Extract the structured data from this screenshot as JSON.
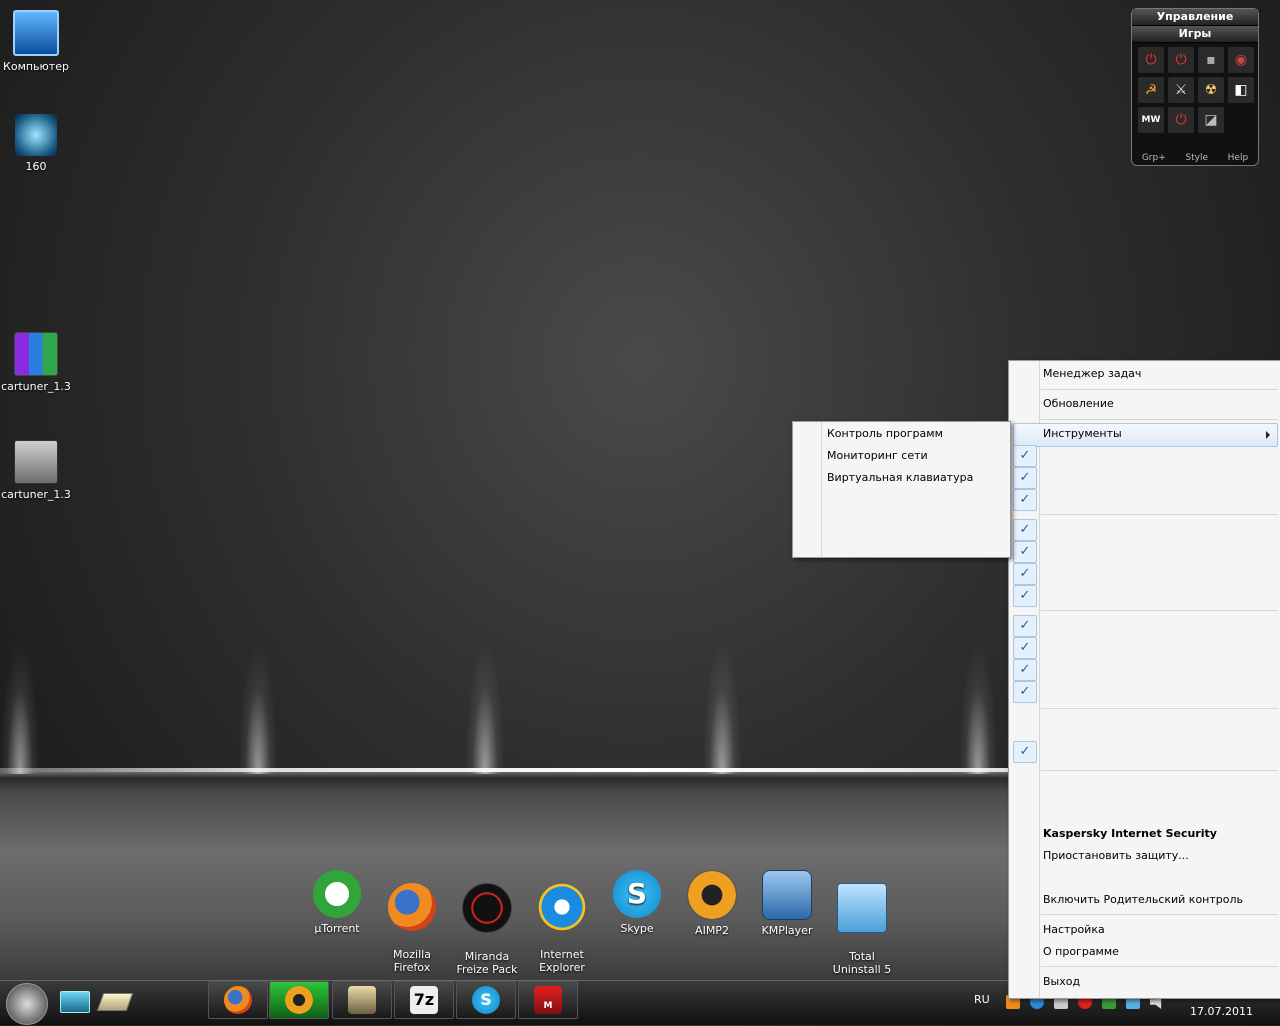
{
  "desktop": {
    "icons": [
      {
        "label": "Компьютер"
      },
      {
        "label": "160"
      },
      {
        "label": "cartuner_1.3"
      },
      {
        "label": "cartuner_1.3"
      }
    ]
  },
  "gadget": {
    "title": "Управление",
    "subtitle": "Игры",
    "footer": [
      "Grp+",
      "Style",
      "Help"
    ],
    "cells": [
      "⏻",
      "⏻",
      "▪",
      "◉",
      "☭",
      "⚔",
      "☢",
      "◧",
      "MW",
      "⏻",
      "◪"
    ]
  },
  "dock": {
    "items": [
      {
        "label": "µTorrent",
        "color": "#2fa53a"
      },
      {
        "label": "Mozilla\nFirefox",
        "color": "#e8641b"
      },
      {
        "label": "Miranda\nFreize Pack",
        "color": "#222222"
      },
      {
        "label": "Internet\nExplorer",
        "color": "#1a8be0"
      },
      {
        "label": "Skype",
        "color": "#19a7e8"
      },
      {
        "label": "AIMP2",
        "color": "#f0a020"
      },
      {
        "label": "KMPlayer",
        "color": "#3a7bbf"
      },
      {
        "label": "Total\nUninstall 5",
        "color": "#4aa0d8"
      }
    ]
  },
  "taskbar": {
    "lang": "RU",
    "date": "17.07.2011",
    "buttons": [
      "firefox-icon",
      "aimp-icon",
      "archive-icon",
      "7zip-icon",
      "skype-icon",
      "metro2033-icon"
    ]
  },
  "context_menu": {
    "items": {
      "task_manager": "Менеджер задач",
      "update": "Обновление",
      "tools": "Инструменты",
      "product": "Kaspersky Internet Security",
      "pause": "Приостановить защиту...",
      "parental": "Включить Родительский контроль",
      "settings": "Настройка",
      "about": "О программе",
      "exit": "Выход"
    }
  },
  "submenu": {
    "items": [
      "Контроль программ",
      "Мониторинг сети",
      "Виртуальная клавиатура"
    ]
  }
}
